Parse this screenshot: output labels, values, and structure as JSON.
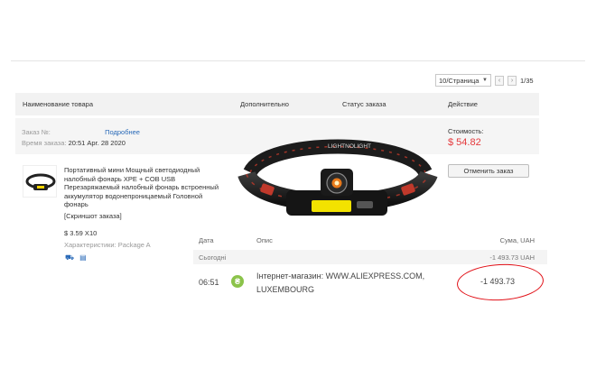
{
  "pager": {
    "per_page": "10/Страница",
    "per_page_arrow": "▼",
    "prev_icon": "chevron-left-icon",
    "next_icon": "chevron-right-icon",
    "prev_glyph": "‹",
    "next_glyph": "›",
    "page_count": "1/35"
  },
  "table_header": {
    "product": "Наименование товара",
    "extra": "Дополнительно",
    "status": "Статус заказа",
    "action": "Действие"
  },
  "order": {
    "number_label": "Заказ №:",
    "more_link": "Подробнее",
    "time_label": "Время заказа:",
    "time_value": "20:51 Apr. 28 2020",
    "cost_label": "Стоимость:",
    "cost_value": "$ 54.82",
    "cancel_button": "Отменить заказ"
  },
  "product": {
    "title": "Портативный мини Мощный светодиодный налобный фонарь XPE + COB USB Перезаряжаемый налобный фонарь встроенный аккумулятор водонепроницаемый Головной фонарь",
    "snapshot_link": "[Скриншот заказа]",
    "price": "$ 3.59 X10",
    "characteristics": "Характеристики: Package A",
    "icons": [
      "delivery-icon",
      "document-icon"
    ],
    "lamp_strap_text": "LIGHTNOLIGHT"
  },
  "statement": {
    "col_date": "Дата",
    "col_desc": "Опис",
    "col_sum": "Сума, UAH",
    "today_label": "Сьогодні",
    "today_total": "-1 493.73 UAH",
    "time": "06:51",
    "merchant_icon": "coin-icon",
    "merchant_glyph": "₴",
    "merchant_line1": "Інтернет-магазин: WWW.ALIEXPRESS.COM,",
    "merchant_line2": "LUXEMBOURG",
    "amount": "-1 493.73",
    "highlight_color": "#e10f16"
  }
}
